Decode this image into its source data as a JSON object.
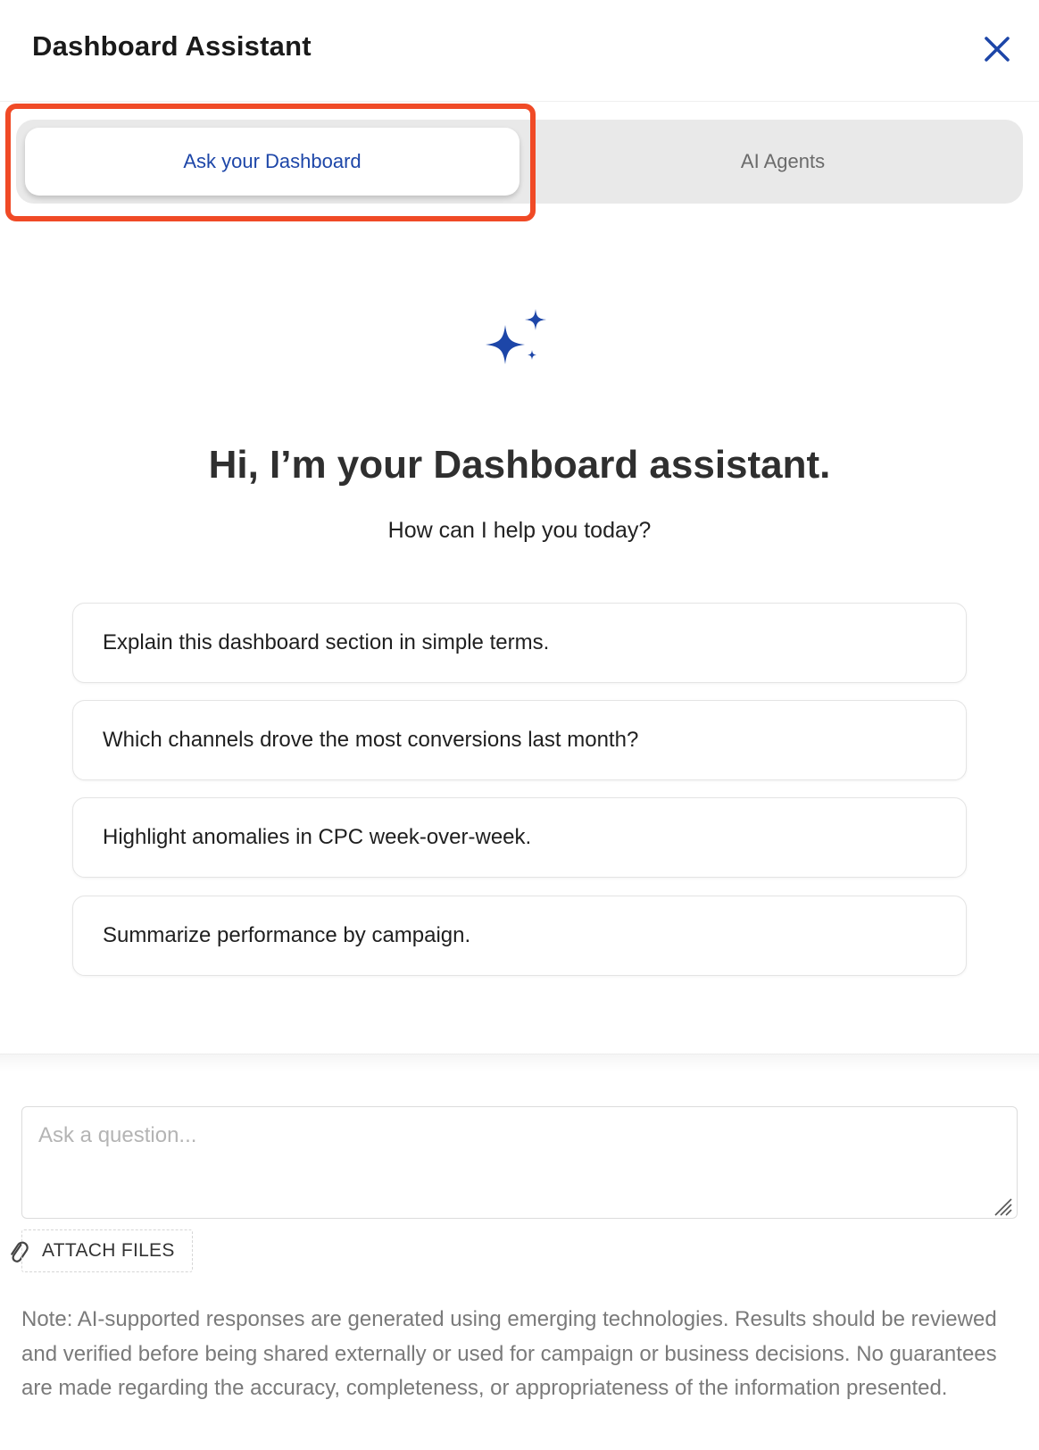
{
  "header": {
    "title": "Dashboard Assistant",
    "close_icon": "close-icon"
  },
  "tabs": [
    {
      "label": "Ask your Dashboard",
      "active": true
    },
    {
      "label": "AI Agents",
      "active": false
    }
  ],
  "hero": {
    "icon": "sparkle-icon",
    "greeting": "Hi, I’m your Dashboard assistant.",
    "subtitle": "How can I help you today?"
  },
  "suggestions": [
    "Explain this dashboard section in simple terms.",
    "Which channels drove the most conversions last month?",
    "Highlight anomalies in CPC week-over-week.",
    "Summarize performance by campaign."
  ],
  "composer": {
    "placeholder": "Ask a question...",
    "value": "",
    "attach_label": "ATTACH FILES",
    "attach_icon": "paperclip-icon"
  },
  "note": "Note: AI-supported responses are generated using emerging technologies. Results should be reviewed and verified before being shared externally or used for campaign or business decisions. No guarantees are made regarding the accuracy, completeness, or appropriateness of the information presented.",
  "colors": {
    "accent": "#1d46a8",
    "highlight": "#f04a26",
    "tab_track": "#e9e9e9"
  }
}
